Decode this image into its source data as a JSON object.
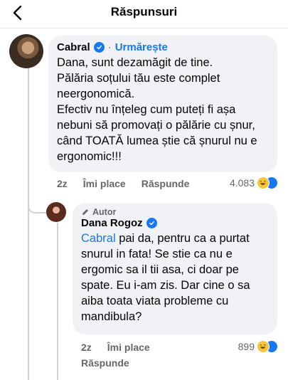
{
  "header": {
    "title": "Răspunsuri"
  },
  "comments": [
    {
      "author": "Cabral",
      "follow_label": "Urmărește",
      "separator": "·",
      "text": "Dana, sunt dezamăgit de tine.\nPălăria soțului tău este complet neergonomică.\nEfectiv nu înțeleg cum puteți fi așa nebuni să promovați o pălărie cu șnur, când TOATĂ lumea știe că șnurul nu e ergonomic!!!",
      "time": "2z",
      "like_label": "Îmi place",
      "reply_label": "Răspunde",
      "reaction_count": "4.083"
    },
    {
      "author_badge": "Autor",
      "author": "Dana Rogoz",
      "mention": "Cabral",
      "text": " pai da, pentru ca a purtat snurul in fata! Se stie ca nu e ergomic sa il tii asa, ci doar pe spate. Eu i-am zis. Dar cine o sa aiba toata viata probleme cu mandibula?",
      "time": "2z",
      "like_label": "Îmi place",
      "reply_label": "Răspunde",
      "reaction_count": "899"
    }
  ],
  "colors": {
    "accent": "#1877f2",
    "bubble": "#f0f2f5",
    "muted": "#65676b"
  }
}
